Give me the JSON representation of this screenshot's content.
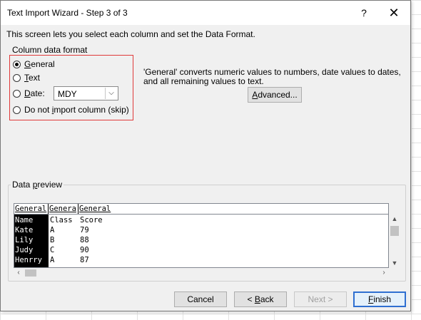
{
  "dialog": {
    "title": "Text Import Wizard - Step 3 of 3",
    "help_label": "?",
    "close_label": "✕",
    "intro": "This screen lets you select each column and set the Data Format."
  },
  "column_format": {
    "legend": "Column data format",
    "options": [
      {
        "accel": "G",
        "rest": "eneral",
        "checked": true
      },
      {
        "accel": "T",
        "rest": "ext",
        "checked": false
      },
      {
        "accel": "D",
        "rest": "ate:",
        "checked": false
      },
      {
        "pre": "Do not ",
        "accel": "i",
        "rest": "mport column (skip)",
        "checked": false
      }
    ],
    "date_value": "MDY",
    "description": "'General' converts numeric values to numbers, date values to dates, and all remaining values to text.",
    "advanced_pre": "",
    "advanced_accel": "A",
    "advanced_rest": "dvanced..."
  },
  "preview": {
    "legend_pre": "Data ",
    "legend_accel": "p",
    "legend_rest": "review",
    "headers": [
      "General",
      "Genera",
      "General"
    ],
    "rows": [
      [
        "Name",
        "Class",
        "Score"
      ],
      [
        "Kate",
        "A",
        "79"
      ],
      [
        "Lily",
        "B",
        "88"
      ],
      [
        "Judy",
        "C",
        "90"
      ],
      [
        "Henrry",
        "A",
        "87"
      ]
    ]
  },
  "buttons": {
    "cancel": "Cancel",
    "back_pre": "< ",
    "back_accel": "B",
    "back_rest": "ack",
    "next": "Next >",
    "finish_accel": "F",
    "finish_rest": "inish"
  },
  "colors": {
    "highlight_border": "#e03a3a",
    "default_button_border": "#2f6fd1"
  }
}
